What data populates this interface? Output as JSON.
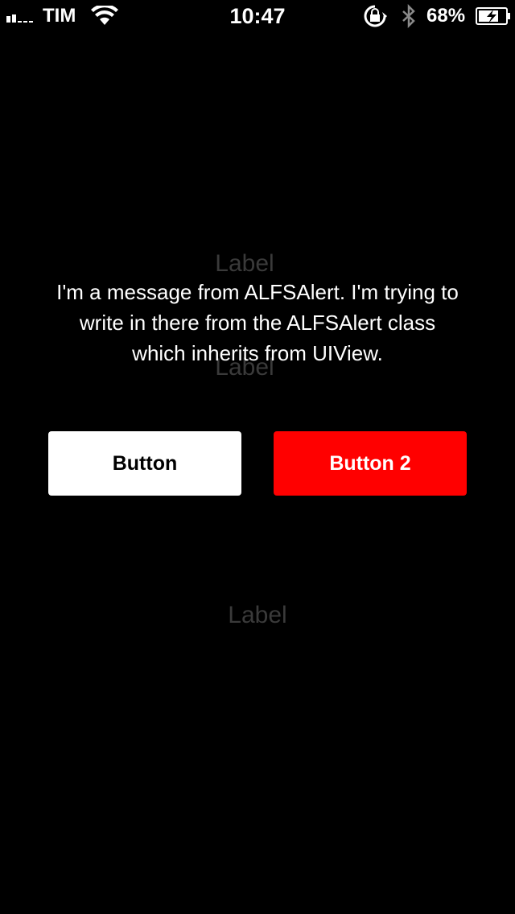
{
  "status_bar": {
    "carrier": "TIM",
    "time": "10:47",
    "battery_percent": "68%",
    "icons": [
      "signal-icon",
      "wifi-icon",
      "rotation-lock-icon",
      "bluetooth-icon",
      "battery-charging-icon"
    ]
  },
  "labels": {
    "top": "Label",
    "middle": "Label",
    "bottom": "Label"
  },
  "alert": {
    "message": "I'm a message from ALFSAlert. I'm trying to write in there from the ALFSAlert class which inherits from UIView.",
    "button_1": "Button",
    "button_2": "Button 2"
  },
  "colors": {
    "background": "#000000",
    "button_1_bg": "#ffffff",
    "button_2_bg": "#ff0000",
    "dim_label": "#3a3a3a"
  }
}
